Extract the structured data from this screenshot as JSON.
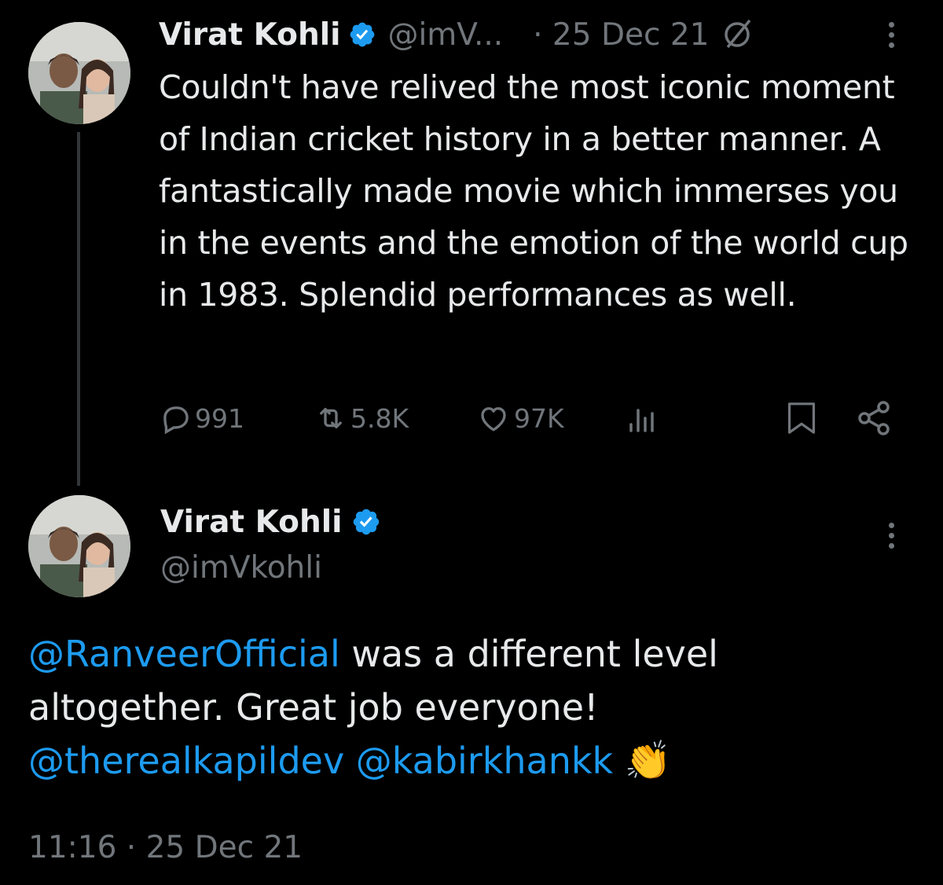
{
  "tweet1": {
    "display_name": "Virat Kohli",
    "handle": "@imV...",
    "date": "· 25 Dec 21",
    "text": "Couldn't have relived the most iconic moment of Indian cricket history in a better manner. A fantastically made movie which immerses you in the events and the emotion of the world cup in 1983. Splendid performances as well.",
    "replies": "991",
    "retweets": "5.8K",
    "likes": "97K"
  },
  "tweet2": {
    "display_name": "Virat Kohli",
    "handle": "@imVkohli",
    "mention1": "@RanveerOfficial",
    "text_part1": " was a different level altogether. Great job everyone!",
    "mention2": "@therealkapildev",
    "mention3": "@kabirkhankk",
    "emoji": "👏",
    "timestamp": "11:16 · 25 Dec 21"
  },
  "colors": {
    "background": "#000000",
    "text": "#e7e9ea",
    "muted": "#71767b",
    "mention": "#1d9bf0",
    "verified": "#1d9bf0"
  },
  "icons": [
    "verified-badge-icon",
    "no-edit-icon",
    "more-icon",
    "reply-icon",
    "retweet-icon",
    "like-icon",
    "views-icon",
    "bookmark-icon",
    "share-icon",
    "clap-emoji"
  ]
}
